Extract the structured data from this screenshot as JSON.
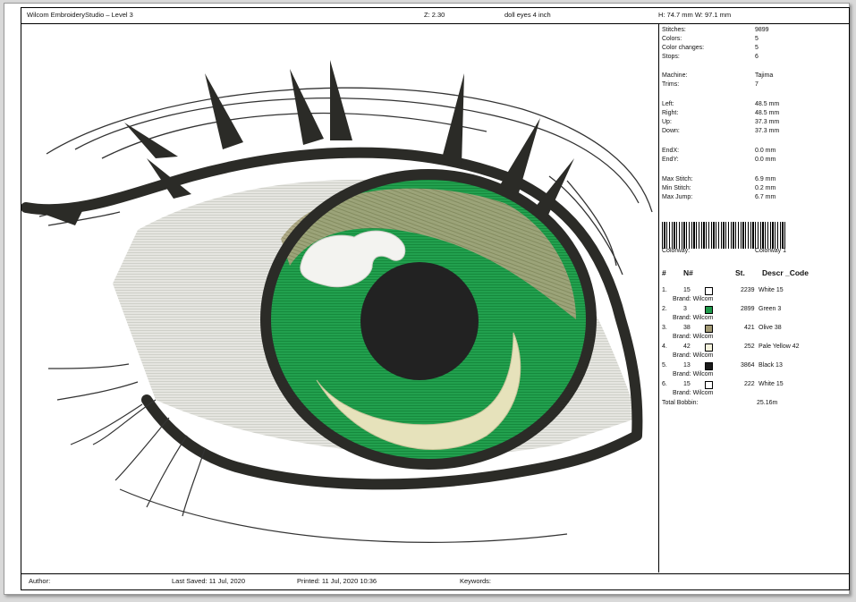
{
  "header": {
    "app_title": "Wilcom EmbroideryStudio – Level 3",
    "zoom": "Z: 2.30",
    "design_name": "doll eyes 4 inch",
    "dimensions": "H: 74.7 mm   W: 97.1 mm"
  },
  "stats": [
    {
      "label": "Stitches:",
      "value": "9899"
    },
    {
      "label": "Colors:",
      "value": "5"
    },
    {
      "label": "Color changes:",
      "value": "5"
    },
    {
      "label": "Stops:",
      "value": "6"
    },
    {
      "label": "Machine:",
      "value": "Tajima"
    },
    {
      "label": "Trims:",
      "value": "7"
    },
    {
      "label": "Left:",
      "value": "48.5 mm"
    },
    {
      "label": "Right:",
      "value": "48.5 mm"
    },
    {
      "label": "Up:",
      "value": "37.3 mm"
    },
    {
      "label": "Down:",
      "value": "37.3 mm"
    },
    {
      "label": "EndX:",
      "value": "0.0 mm"
    },
    {
      "label": "EndY:",
      "value": "0.0 mm"
    },
    {
      "label": "Max Stitch:",
      "value": "6.9 mm"
    },
    {
      "label": "Min Stitch:",
      "value": "0.2 mm"
    },
    {
      "label": "Max Jump:",
      "value": "6.7 mm"
    }
  ],
  "colorway": {
    "label": "Colorway:",
    "value": "Colorway 1"
  },
  "table": {
    "headers": [
      "#",
      "N#",
      "St.",
      "Descr _Code"
    ],
    "rows": [
      {
        "idx": "1.",
        "n": "15",
        "swatch": "#ffffff",
        "st": "2239",
        "descr": "White 15",
        "brand": "Brand: Wilcom"
      },
      {
        "idx": "2.",
        "n": "3",
        "swatch": "#1e9a4a",
        "st": "2899",
        "descr": "Green 3",
        "brand": "Brand: Wilcom"
      },
      {
        "idx": "3.",
        "n": "38",
        "swatch": "#a39a74",
        "st": "421",
        "descr": "Olive 38",
        "brand": "Brand: Wilcom"
      },
      {
        "idx": "4.",
        "n": "42",
        "swatch": "#f4f2dc",
        "st": "252",
        "descr": "Pale Yellow 42",
        "brand": "Brand: Wilcom"
      },
      {
        "idx": "5.",
        "n": "13",
        "swatch": "#1a1a1a",
        "st": "3864",
        "descr": "Black 13",
        "brand": "Brand: Wilcom"
      },
      {
        "idx": "6.",
        "n": "15",
        "swatch": "#ffffff",
        "st": "222",
        "descr": "White 15",
        "brand": "Brand: Wilcom"
      }
    ],
    "total_label": "Total Bobbin:",
    "total_value": "25.16m"
  },
  "footer": {
    "author": "Author:",
    "last_saved": "Last Saved: 11 Jul, 2020",
    "printed": "Printed: 11 Jul, 2020 10:36",
    "keywords": "Keywords:"
  },
  "colors": {
    "thread_black": "#2b2b27",
    "iris_green": "#1e9a4a",
    "sclera": "#e3e3de",
    "olive": "#a7a27c",
    "pale_yellow": "#e7e3bd"
  }
}
